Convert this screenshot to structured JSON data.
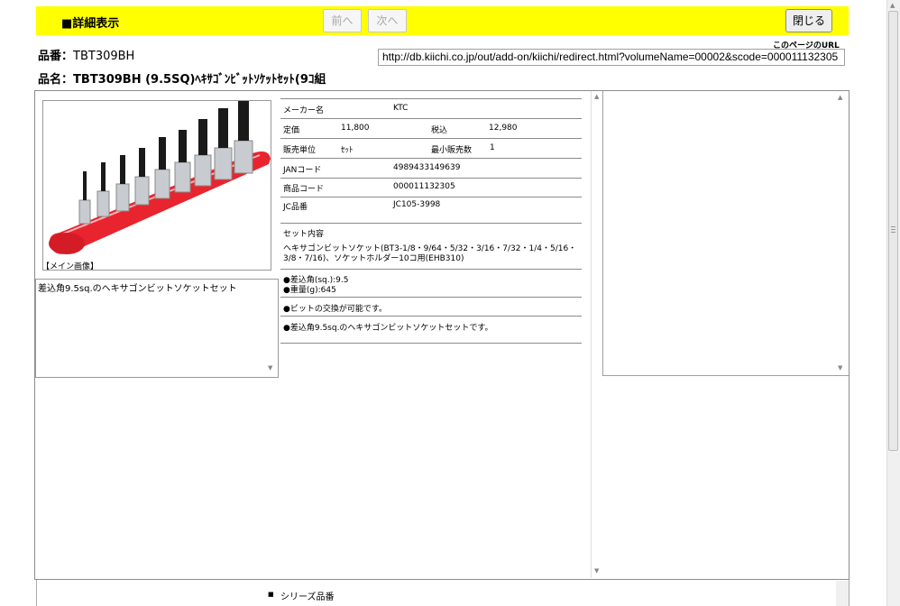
{
  "header": {
    "title": "■詳細表示",
    "prev_label": "前へ",
    "next_label": "次へ",
    "close_label": "閉じる"
  },
  "product": {
    "hinban_label": "品番：",
    "hinban": "TBT309BH",
    "hinmei_label": "品名：",
    "hinmei": "TBT309BH (9.5SQ)ﾍｷｻｺﾞﾝﾋﾞｯﾄｿｹｯﾄｾｯﾄ(9ｺ組"
  },
  "page_url": {
    "label": "このページのURL",
    "value": "http://db.kiichi.co.jp/out/add-on/kiichi/redirect.html?volumeName=00002&scode=000011132305"
  },
  "image": {
    "caption": "【メイン画像】",
    "description": "差込角9.5sq.のヘキサゴンビットソケットセット",
    "colors": {
      "holder": "#e8242e",
      "socket": "#c8ccd0",
      "bit": "#1a1a1a"
    }
  },
  "specs": {
    "maker_label": "メーカー名",
    "maker": "KTC",
    "list_price_label": "定価",
    "list_price": "11,800",
    "tax_in_label": "税込",
    "tax_in": "12,980",
    "sales_unit_label": "販売単位",
    "sales_unit": "ｾｯﾄ",
    "min_qty_label": "最小販売数",
    "min_qty": "1",
    "jan_label": "JANコード",
    "jan": "4989433149639",
    "product_code_label": "商品コード",
    "product_code": "000011132305",
    "jc_label": "JC品番",
    "jc": "JC105-3998",
    "set_contents_label": "セット内容",
    "set_contents": "ヘキサゴンビットソケット(BT3-1/8・9/64・5/32・3/16・7/32・1/4・5/16・3/8・7/16)、ソケットホルダー10コ用(EHB310)",
    "spec1": "●差込角(sq.):9.5",
    "spec2": "●重量(g):645",
    "feature1": "●ビットの交換が可能です。",
    "feature2": "●差込角9.5sq.のヘキサゴンビットソケットセットです。"
  },
  "series": {
    "label": "シリーズ品番"
  }
}
